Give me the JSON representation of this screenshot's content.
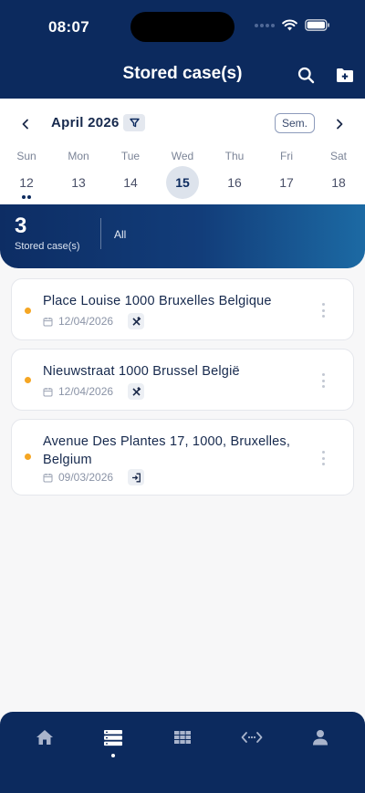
{
  "status_bar": {
    "time": "08:07"
  },
  "header": {
    "title": "Stored case(s)"
  },
  "calendar": {
    "month": "April 2026",
    "sem_label": "Sem.",
    "weekdays": [
      "Sun",
      "Mon",
      "Tue",
      "Wed",
      "Thu",
      "Fri",
      "Sat"
    ],
    "days": [
      "12",
      "13",
      "14",
      "15",
      "16",
      "17",
      "18"
    ],
    "selected_day": "15"
  },
  "summary": {
    "count": "3",
    "label": "Stored case(s)",
    "filter": "All"
  },
  "cases": [
    {
      "address": "Place Louise 1000 Bruxelles Belgique",
      "date": "12/04/2026",
      "type_icon": "tools-icon"
    },
    {
      "address": "Nieuwstraat 1000 Brussel België",
      "date": "12/04/2026",
      "type_icon": "tools-icon"
    },
    {
      "address": "Avenue Des Plantes 17, 1000, Bruxelles, Belgium",
      "date": "09/03/2026",
      "type_icon": "login-icon"
    }
  ],
  "colors": {
    "primary": "#0c2a5e",
    "status_dot": "#f5a623",
    "background": "#f7f7f8"
  },
  "tabbar": {
    "items": [
      "home-icon",
      "list-icon",
      "grid-icon",
      "code-icon",
      "user-icon"
    ],
    "active": "list-icon"
  }
}
